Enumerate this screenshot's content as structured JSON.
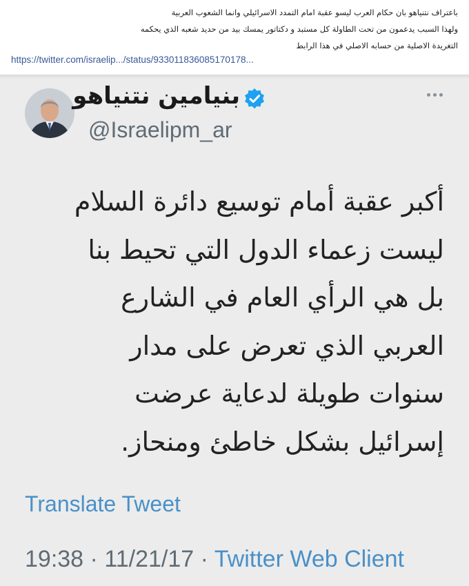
{
  "post": {
    "lines": [
      "باعتراف نتنياهو بان حكام العرب  ليسو عقبة امام التمدد الاسرائيلي وانما الشعوب العربية",
      "ولهذا السبب يدعمون من تحت الطاولة كل  مستبد و دكتاتور يمسك بيد من حديد شعبه الذي يحكمه",
      "التغريدة الاصلية من حسابه الاصلي في هذا الرابط"
    ],
    "link_text": "https://twitter.com/israelip.../status/933011836085170178..."
  },
  "tweet": {
    "display_name": "بنيامين نتنياهو",
    "handle": "@Israelipm_ar",
    "body_lines": [
      "أكبر عقبة أمام توسيع دائرة السلام",
      "ليست زعماء الدول التي تحيط بنا",
      "بل هي الرأي العام في الشارع",
      "العربي الذي تعرض على مدار",
      "سنوات طويلة لدعاية عرضت",
      "إسرائيل بشكل خاطئ ومنحاز."
    ],
    "translate_label": "Translate Tweet",
    "time": "19:38",
    "date": "11/21/17",
    "client": "Twitter Web Client"
  },
  "colors": {
    "link": "#385898",
    "twitter_blue": "#4a90c8",
    "verified": "#1da1f2",
    "card_bg": "#ececec"
  },
  "icons": {
    "verified": "verified-badge-icon",
    "more": "more-dots-icon"
  }
}
